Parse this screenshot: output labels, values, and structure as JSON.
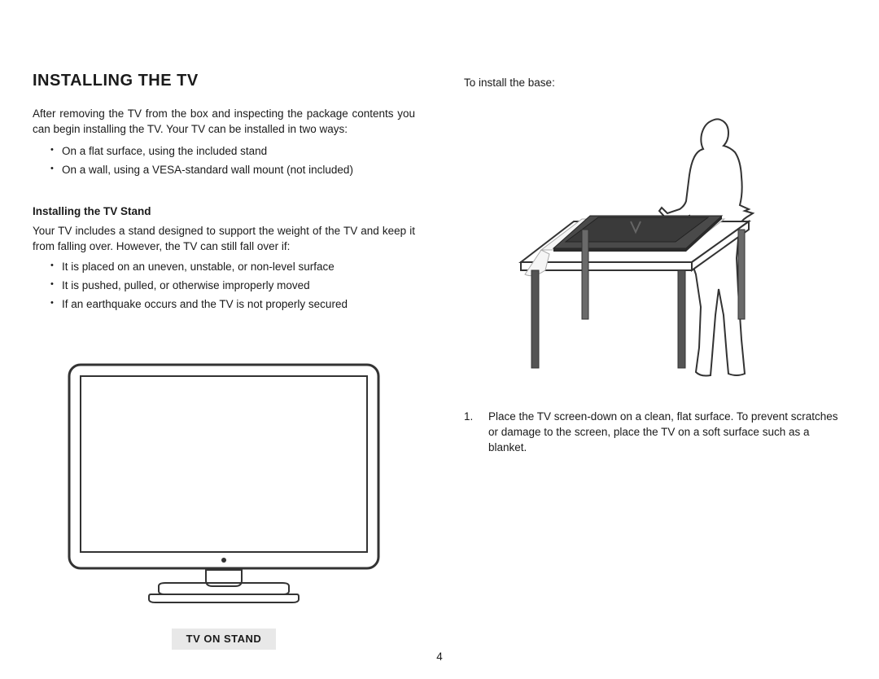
{
  "heading": "INSTALLING THE TV",
  "intro": "After removing the TV from the box and inspecting the package contents you can begin installing the TV. Your TV can be installed in two ways:",
  "ways": [
    "On a flat surface, using the included stand",
    "On a wall, using a VESA-standard wall mount (not included)"
  ],
  "stand_heading": "Installing the TV Stand",
  "stand_intro": "Your TV includes a stand designed to support the weight of the TV and keep it from falling over. However, the TV can still fall over if:",
  "fall_reasons": [
    "It is placed on an uneven, unstable, or non-level surface",
    "It is pushed, pulled, or otherwise improperly moved",
    "If an earthquake occurs and the TV is not properly secured"
  ],
  "caption_tv_stand": "TV ON STAND",
  "right_intro": "To install the base:",
  "step1_num": "1.",
  "step1": "Place the TV screen-down on a clean, flat surface. To prevent scratches or damage to the screen, place the TV on a soft surface such as a blanket.",
  "page_number": "4"
}
